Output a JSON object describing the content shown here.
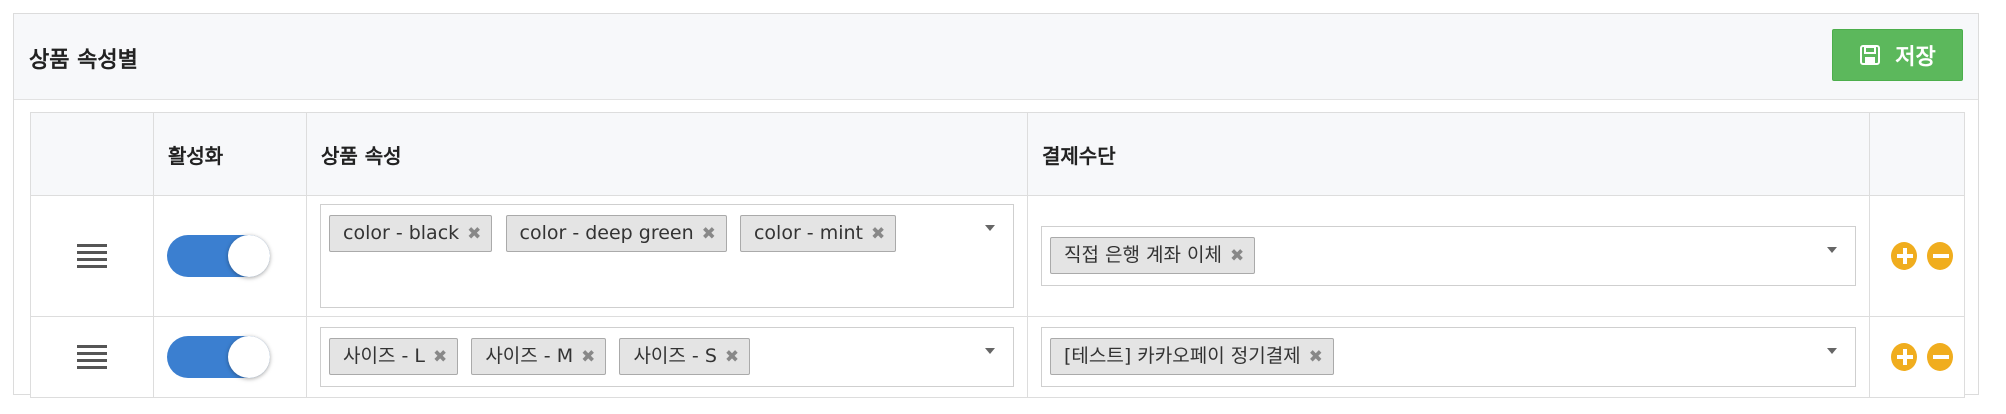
{
  "panel": {
    "title": "상품 속성별",
    "save_label": "저장"
  },
  "table": {
    "headers": [
      "",
      "활성화",
      "상품 속성",
      "결제수단",
      ""
    ],
    "rows": [
      {
        "active": true,
        "attributes": [
          "color - black",
          "color - deep green",
          "color - mint"
        ],
        "payments": [
          "직접 은행 계좌 이체"
        ]
      },
      {
        "active": true,
        "attributes": [
          "사이즈 - L",
          "사이즈 - M",
          "사이즈 - S"
        ],
        "payments": [
          "[테스트] 카카오페이 정기결제"
        ]
      }
    ]
  },
  "colors": {
    "save_button": "#5cb85c",
    "toggle_on": "#3b7fd0",
    "action_button": "#f0ad1e"
  },
  "icons": {
    "save": "floppy-disk-icon",
    "drag": "drag-handle-icon",
    "remove_tag": "close-icon",
    "add_row": "plus-circle-icon",
    "remove_row": "minus-circle-icon",
    "dropdown": "chevron-down-icon"
  }
}
